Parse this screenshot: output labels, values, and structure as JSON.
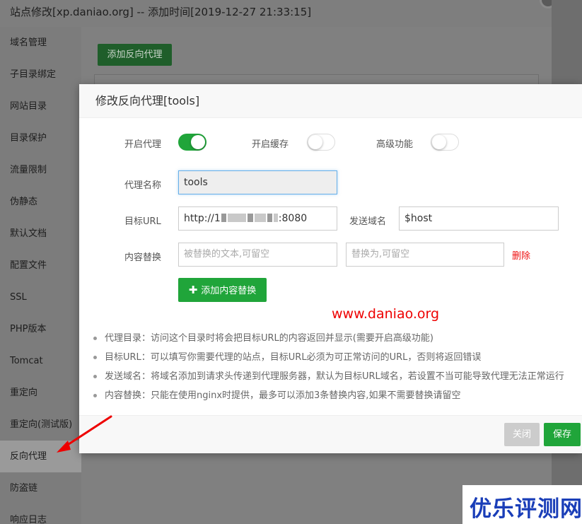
{
  "background": {
    "title": "站点修改[xp.daniao.org] -- 添加时间[2019-12-27 21:33:15]",
    "sidebar": [
      {
        "label": "域名管理"
      },
      {
        "label": "子目录绑定"
      },
      {
        "label": "网站目录"
      },
      {
        "label": "目录保护"
      },
      {
        "label": "流量限制"
      },
      {
        "label": "伪静态"
      },
      {
        "label": "默认文档"
      },
      {
        "label": "配置文件"
      },
      {
        "label": "SSL"
      },
      {
        "label": "PHP版本"
      },
      {
        "label": "Tomcat"
      },
      {
        "label": "重定向"
      },
      {
        "label": "重定向(测试版)"
      },
      {
        "label": "反向代理"
      },
      {
        "label": "防盗链"
      },
      {
        "label": "响应日志"
      }
    ],
    "add_button": "添加反向代理"
  },
  "modal": {
    "title": "修改反向代理[tools]",
    "toggles": {
      "proxy": {
        "label": "开启代理",
        "state": "on"
      },
      "cache": {
        "label": "开启缓存",
        "state": "off"
      },
      "advanced": {
        "label": "高级功能",
        "state": "off"
      }
    },
    "proxy_name": {
      "label": "代理名称",
      "value": "tools"
    },
    "target_url": {
      "label": "目标URL",
      "prefix": "http://1",
      "suffix": ":8080"
    },
    "send_domain": {
      "label": "发送域名",
      "value": "$host"
    },
    "content_replace": {
      "label": "内容替换",
      "from_placeholder": "被替换的文本,可留空",
      "to_placeholder": "替换为,可留空",
      "delete_label": "删除"
    },
    "add_replace_button": "添加内容替换",
    "watermark": "www.daniao.org",
    "tips": [
      "代理目录：访问这个目录时将会把目标URL的内容返回并显示(需要开启高级功能)",
      "目标URL：可以填写你需要代理的站点，目标URL必须为可正常访问的URL，否则将返回错误",
      "发送域名：将域名添加到请求头传递到代理服务器，默认为目标URL域名，若设置不当可能导致代理无法正常运行",
      "内容替换：只能在使用nginx时提供，最多可以添加3条替换内容,如果不需要替换请留空"
    ],
    "close_button": "关闭",
    "save_button": "保存"
  },
  "brand": "优乐评测网",
  "colors": {
    "accent": "#20a53a",
    "danger": "#ee1111",
    "brand": "#1a3eb8"
  }
}
